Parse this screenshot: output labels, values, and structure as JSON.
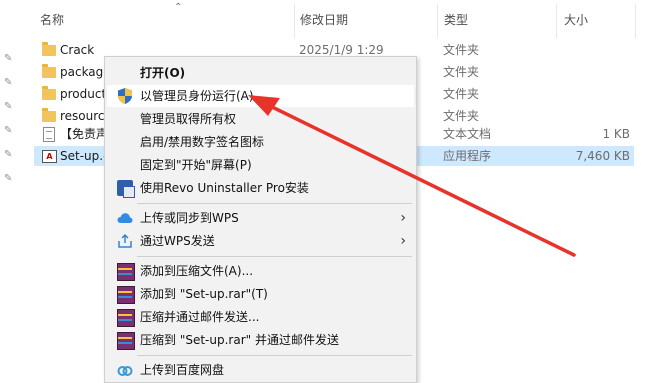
{
  "explorer": {
    "columns": {
      "name": "名称",
      "date": "修改日期",
      "type": "类型",
      "size": "大小"
    },
    "rows": [
      {
        "name": "Crack",
        "date": "2025/1/9 1:29",
        "type": "文件夹",
        "size": "",
        "icon": "folder-icon"
      },
      {
        "name": "package",
        "date": "",
        "type": "文件夹",
        "size": "",
        "icon": "folder-icon"
      },
      {
        "name": "product",
        "date": "",
        "type": "文件夹",
        "size": "",
        "icon": "folder-icon"
      },
      {
        "name": "resource",
        "date": "",
        "type": "文件夹",
        "size": "",
        "icon": "folder-icon"
      },
      {
        "name": "【免责声",
        "date": "",
        "type": "文本文档",
        "size": "1 KB",
        "icon": "text-document-icon"
      },
      {
        "name": "Set-up.e",
        "date": "",
        "type": "应用程序",
        "size": "7,460 KB",
        "icon": "adobe-app-icon",
        "exe_glyph": "A"
      }
    ]
  },
  "context_menu": {
    "items": [
      {
        "label": "打开(O)"
      },
      {
        "label": "以管理员身份运行(A)"
      },
      {
        "label": "管理员取得所有权"
      },
      {
        "label": "启用/禁用数字签名图标"
      },
      {
        "label": "固定到\"开始\"屏幕(P)"
      },
      {
        "label": "使用Revo Uninstaller Pro安装"
      },
      {
        "label": "上传或同步到WPS"
      },
      {
        "label": "通过WPS发送"
      },
      {
        "label": "添加到压缩文件(A)..."
      },
      {
        "label": "添加到 \"Set-up.rar\"(T)"
      },
      {
        "label": "压缩并通过邮件发送..."
      },
      {
        "label": "压缩到 \"Set-up.rar\" 并通过邮件发送"
      },
      {
        "label": "上传到百度网盘"
      }
    ],
    "submenu_glyph": "›"
  },
  "colors": {
    "selection": "#cde8ff",
    "annotation_arrow": "#e8332a",
    "menu_background": "#f2f2f2"
  }
}
